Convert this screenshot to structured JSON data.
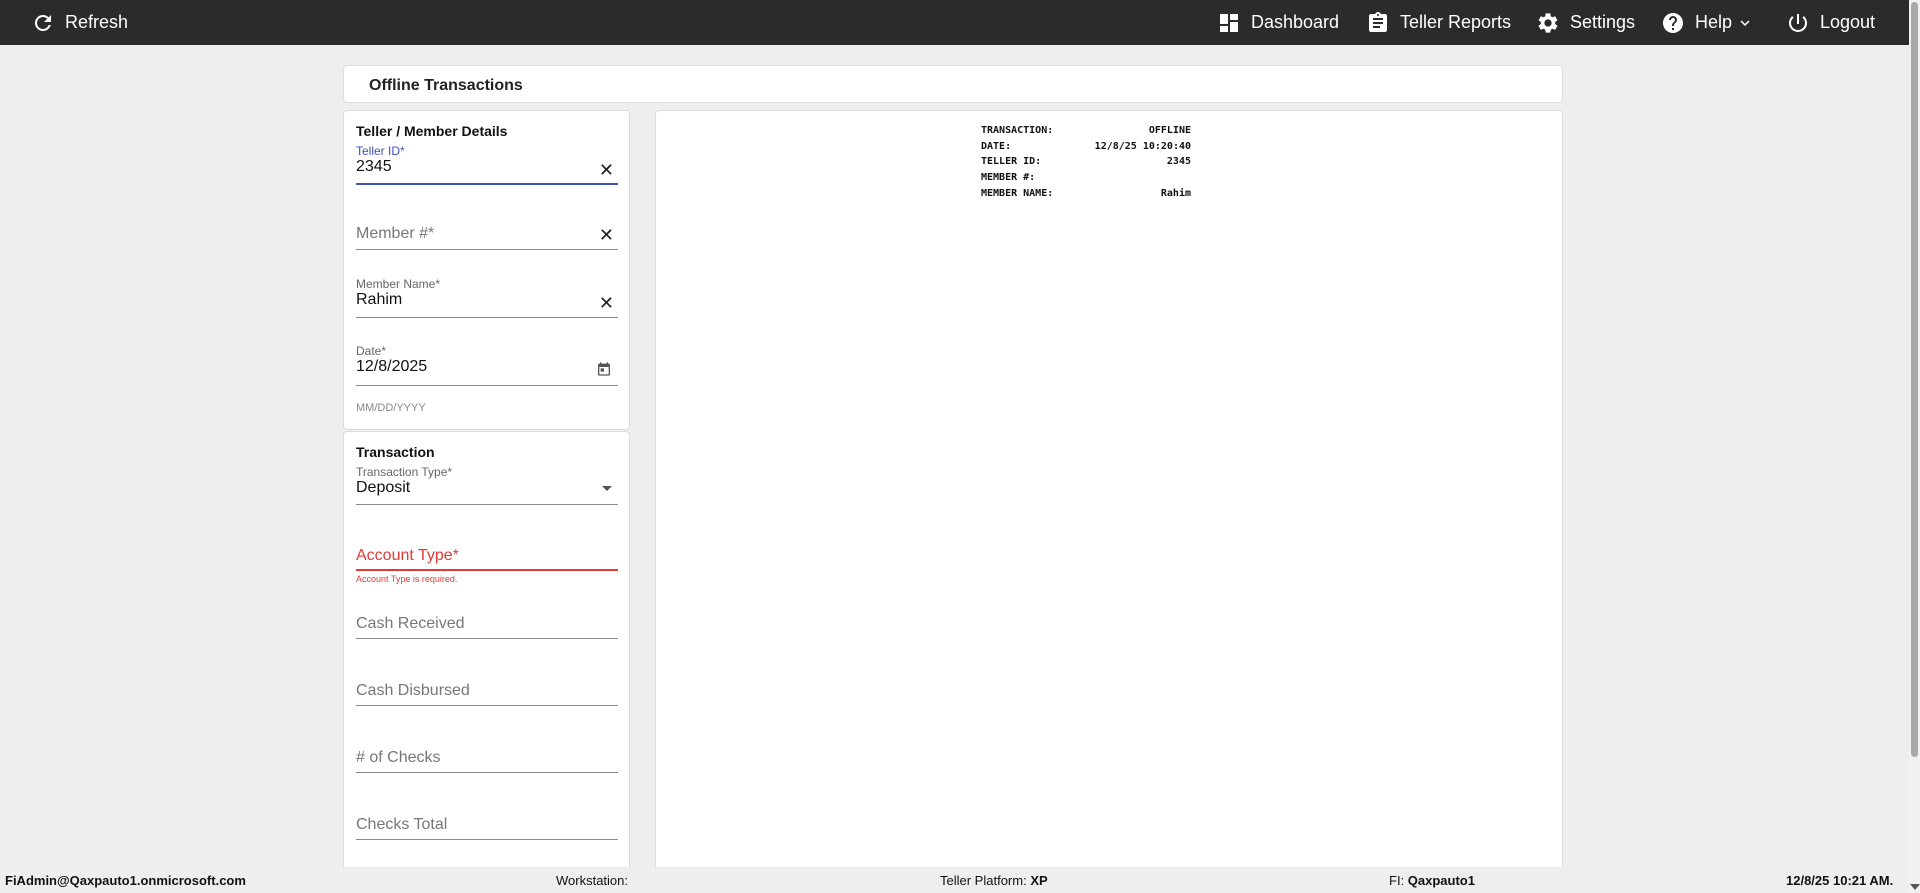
{
  "topbar": {
    "refresh": {
      "label": "Refresh",
      "icon": "refresh-icon"
    },
    "dashboard": {
      "label": "Dashboard",
      "icon": "dashboard-icon"
    },
    "reports": {
      "label": "Teller Reports",
      "icon": "clipboard-icon"
    },
    "settings": {
      "label": "Settings",
      "icon": "gear-icon"
    },
    "help": {
      "label": "Help",
      "icon": "help-icon"
    },
    "logout": {
      "label": "Logout",
      "icon": "power-icon"
    }
  },
  "page": {
    "title": "Offline Transactions"
  },
  "member_details": {
    "title": "Teller / Member Details",
    "teller_id": {
      "label": "Teller ID*",
      "value": "2345"
    },
    "member_number": {
      "placeholder": "Member #*",
      "value": ""
    },
    "member_name": {
      "label": "Member Name*",
      "value": "Rahim"
    },
    "date": {
      "label": "Date*",
      "value": "12/8/2025",
      "hint": "MM/DD/YYYY"
    }
  },
  "transaction": {
    "title": "Transaction",
    "type": {
      "label": "Transaction Type*",
      "value": "Deposit"
    },
    "account_type": {
      "placeholder": "Account Type*",
      "error": "Account Type is required."
    },
    "cash_received": {
      "placeholder": "Cash Received"
    },
    "cash_disbursed": {
      "placeholder": "Cash Disbursed"
    },
    "num_checks": {
      "placeholder": "# of Checks"
    },
    "checks_total": {
      "placeholder": "Checks Total"
    }
  },
  "receipt": {
    "rows": [
      {
        "key": "TRANSACTION:",
        "value": "OFFLINE"
      },
      {
        "key": "DATE:",
        "value": "12/8/25 10:20:40"
      },
      {
        "key": "TELLER ID:",
        "value": "2345"
      },
      {
        "key": "MEMBER #:",
        "value": ""
      },
      {
        "key": "MEMBER NAME:",
        "value": "Rahim"
      }
    ]
  },
  "footer": {
    "user": "FiAdmin@Qaxpauto1.onmicrosoft.com",
    "workstation_label": "Workstation:",
    "workstation_value": "",
    "platform_label": "Teller Platform:",
    "platform_value": "XP",
    "fi_label": "FI:",
    "fi_value": "Qaxpauto1",
    "datetime": "12/8/25 10:21 AM."
  },
  "colors": {
    "topbar": "#2b2b2b",
    "focus": "#3f51b5",
    "error": "#e53935"
  }
}
